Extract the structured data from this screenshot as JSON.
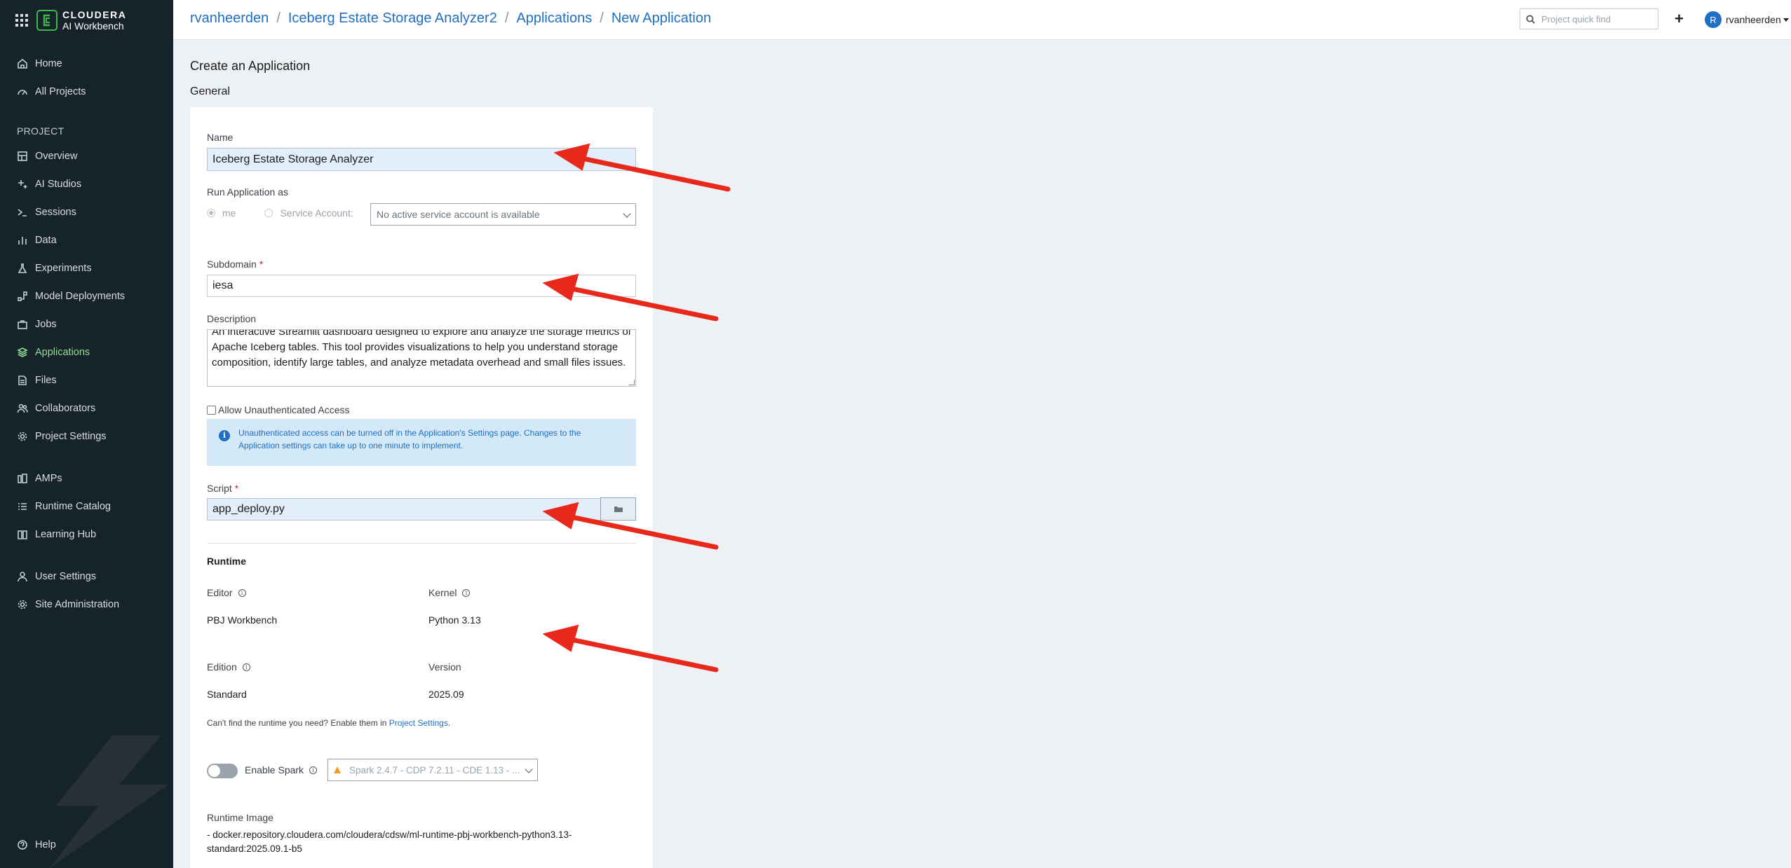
{
  "brand": {
    "line1": "CLOUDERA",
    "line2": "AI Workbench"
  },
  "sidebar": {
    "top_items": [
      {
        "label": "Home",
        "icon": "home-icon"
      },
      {
        "label": "All Projects",
        "icon": "gauge-icon"
      }
    ],
    "section_label": "PROJECT",
    "project_items": [
      {
        "label": "Overview",
        "icon": "overview-icon"
      },
      {
        "label": "AI Studios",
        "icon": "sparkle-icon"
      },
      {
        "label": "Sessions",
        "icon": "terminal-icon"
      },
      {
        "label": "Data",
        "icon": "bar-chart-icon"
      },
      {
        "label": "Experiments",
        "icon": "flask-icon"
      },
      {
        "label": "Model Deployments",
        "icon": "deployments-icon"
      },
      {
        "label": "Jobs",
        "icon": "briefcase-icon"
      },
      {
        "label": "Applications",
        "icon": "layers-icon",
        "active": true
      },
      {
        "label": "Files",
        "icon": "file-icon"
      },
      {
        "label": "Collaborators",
        "icon": "people-icon"
      },
      {
        "label": "Project Settings",
        "icon": "gear-icon"
      }
    ],
    "bottom_items": [
      {
        "label": "AMPs",
        "icon": "amps-icon"
      },
      {
        "label": "Runtime Catalog",
        "icon": "list-icon"
      },
      {
        "label": "Learning Hub",
        "icon": "book-icon"
      }
    ],
    "user_items": [
      {
        "label": "User Settings",
        "icon": "user-icon"
      },
      {
        "label": "Site Administration",
        "icon": "gear-icon"
      }
    ],
    "help": "Help",
    "active_color": "#8fe08f"
  },
  "header": {
    "breadcrumbs": [
      "rvanheerden",
      "Iceberg Estate Storage Analyzer2",
      "Applications",
      "New Application"
    ],
    "search_placeholder": "Project quick find",
    "user_initial": "R",
    "username": "rvanheerden"
  },
  "page": {
    "title": "Create an Application",
    "section": "General"
  },
  "form": {
    "name_label": "Name",
    "name_value": "Iceberg Estate Storage Analyzer",
    "run_as_label": "Run Application as",
    "run_as_me": "me",
    "run_as_service": "Service Account:",
    "service_account_select": "No active service account is available",
    "subdomain_label": "Subdomain",
    "subdomain_value": "iesa",
    "description_label": "Description",
    "description_value": "An interactive Streamlit dashboard designed to explore and analyze the storage metrics of Apache Iceberg tables. This tool provides visualizations to help you understand storage composition, identify large tables, and analyze metadata overhead and small files issues.",
    "allow_unauth_label": "Allow Unauthenticated Access",
    "info_text": "Unauthenticated access can be turned off in the Application's Settings page. Changes to the Application settings can take up to one minute to implement.",
    "script_label": "Script",
    "script_value": "app_deploy.py",
    "required_mark": "*"
  },
  "runtime": {
    "heading": "Runtime",
    "editor_label": "Editor",
    "editor_value": "PBJ Workbench",
    "kernel_label": "Kernel",
    "kernel_value": "Python 3.13",
    "edition_label": "Edition",
    "edition_value": "Standard",
    "version_label": "Version",
    "version_value": "2025.09",
    "note_prefix": "Can't find the runtime you need? Enable them in ",
    "note_link": "Project Settings",
    "note_suffix": ".",
    "spark_label": "Enable Spark",
    "spark_select": "Spark 2.4.7 - CDP 7.2.11 - CDE 1.13 - ...",
    "image_label": "Runtime Image",
    "image_value": "- docker.repository.cloudera.com/cloudera/cdsw/ml-runtime-pbj-workbench-python3.13-standard:2025.09.1-b5"
  },
  "colors": {
    "sidebar_bg": "#17232b",
    "link": "#1f6fc5",
    "arrow": "#e8281b",
    "info_bg": "#d4e9f7"
  }
}
